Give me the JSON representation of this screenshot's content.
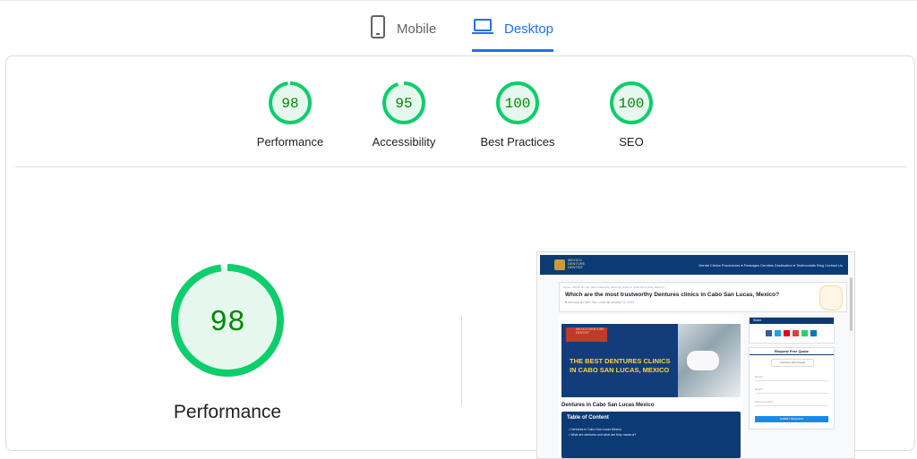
{
  "tabs": {
    "mobile": "Mobile",
    "desktop": "Desktop",
    "active": "Desktop"
  },
  "scores": [
    {
      "label": "Performance",
      "value": "98",
      "percent": 98
    },
    {
      "label": "Accessibility",
      "value": "95",
      "percent": 95
    },
    {
      "label": "Best Practices",
      "value": "100",
      "percent": 100
    },
    {
      "label": "SEO",
      "value": "100",
      "percent": 100
    }
  ],
  "colors": {
    "pass": "#0cce6b",
    "pass_text": "#008800",
    "pass_fill": "#e6f8ee",
    "active_tab": "#1a73e8"
  },
  "performance": {
    "value": "98",
    "percent": 98,
    "label": "Performance"
  },
  "thumbnail": {
    "logo_text": "MEXICO DENTURE DENTIST",
    "menu": "Dental Clinics   Procedures ▾   Packages   Dentists   Destination ▾   Testimonials   Blog   Contact Us",
    "breadcrumb": "Home › Which are the most trustworthy Dentures clinics in Cabo San Lucas, Mexico?",
    "page_title": "Which are the most trustworthy Dentures clinics in Cabo San Lucas, Mexico?",
    "meta": "■ Mexican  ■ Cabo San Lucas  ■ January 21, 2023",
    "banner_logo_text": "MEXICO DENTURE DENTIST",
    "banner_text": "THE BEST DENTURES CLINICS IN CABO SAN LUCAS, MEXICO",
    "subheading": "Dentures in Cabo San Lucas Mexico",
    "toc_title": "Table of Content",
    "toc_items": [
      "• Dentures in Cabo San Lucas Mexico",
      "• What are dentures and what are they made of?"
    ],
    "share_title": "Share",
    "quote_title": "Request Free Quote",
    "google_button": "Continue with Google",
    "fields": [
      "Name*",
      "Email*",
      "Phone number*"
    ],
    "submit": "SUBMIT REQUEST"
  }
}
